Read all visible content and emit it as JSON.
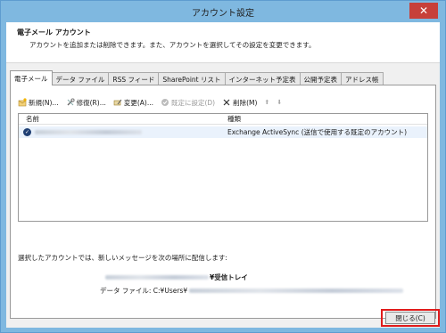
{
  "window": {
    "title": "アカウント設定",
    "close_glyph": "✕"
  },
  "header": {
    "title": "電子メール アカウント",
    "description": "アカウントを追加または削除できます。また、アカウントを選択してその設定を変更できます。"
  },
  "tabs": [
    {
      "label": "電子メール",
      "active": true
    },
    {
      "label": "データ ファイル"
    },
    {
      "label": "RSS フィード"
    },
    {
      "label": "SharePoint リスト"
    },
    {
      "label": "インターネット予定表"
    },
    {
      "label": "公開予定表"
    },
    {
      "label": "アドレス帳"
    }
  ],
  "toolbar": {
    "new_label": "新規(N)...",
    "repair_label": "修復(R)...",
    "change_label": "変更(A)...",
    "set_default_label": "既定に設定(D)",
    "remove_label": "削除(M)",
    "up_glyph": "⬆",
    "down_glyph": "⬇"
  },
  "list": {
    "col_name": "名前",
    "col_type": "種類",
    "rows": [
      {
        "type": "Exchange ActiveSync (送信で使用する既定のアカウント)"
      }
    ]
  },
  "delivery": {
    "label": "選択したアカウントでは、新しいメッセージを次の場所に配信します:",
    "target_suffix": "¥受信トレイ",
    "data_file_prefix": "データ ファイル: C:¥Users¥"
  },
  "footer": {
    "close_label": "閉じる(C)"
  },
  "colors": {
    "accent_highlight": "#e01b1b",
    "window_frame": "#7fb8e0"
  }
}
